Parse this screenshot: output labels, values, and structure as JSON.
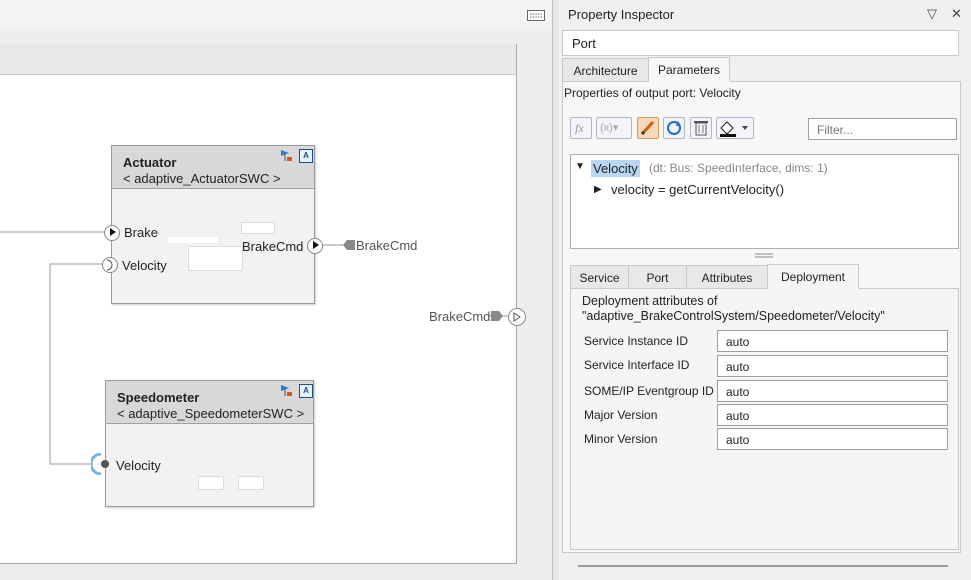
{
  "inspector": {
    "title": "Property Inspector",
    "port_field": "Port",
    "top_tabs": [
      "Architecture",
      "Parameters"
    ],
    "properties_title": "Properties of output port: Velocity",
    "filter_placeholder": "Filter...",
    "tree": {
      "root_label": "Velocity",
      "root_meta": "(dt: Bus: SpeedInterface, dims: 1)",
      "child_label": "velocity = getCurrentVelocity()"
    },
    "lower_tabs": [
      "Service",
      "Port",
      "Attributes",
      "Deployment"
    ],
    "deployment": {
      "heading_line1": "Deployment attributes of",
      "heading_line2": "\"adaptive_BrakeControlSystem/Speedometer/Velocity\"",
      "rows": [
        {
          "label": "Service Instance ID",
          "value": "auto"
        },
        {
          "label": "Service Interface ID",
          "value": "auto"
        },
        {
          "label": "SOME/IP Eventgroup ID",
          "value": "auto"
        },
        {
          "label": "Major Version",
          "value": "auto"
        },
        {
          "label": "Minor Version",
          "value": "auto"
        }
      ]
    }
  },
  "diagram": {
    "actuator": {
      "name": "Actuator",
      "type": "< adaptive_ActuatorSWC >",
      "ports": {
        "brake": "Brake",
        "velocity": "Velocity",
        "brake_cmd": "BrakeCmd"
      },
      "external_label": "BrakeCmd"
    },
    "speedometer": {
      "name": "Speedometer",
      "type": "< adaptive_SpeedometerSWC >",
      "ports": {
        "velocity": "Velocity"
      }
    },
    "root_port_label": "BrakeCmd",
    "badge_letter": "A"
  }
}
